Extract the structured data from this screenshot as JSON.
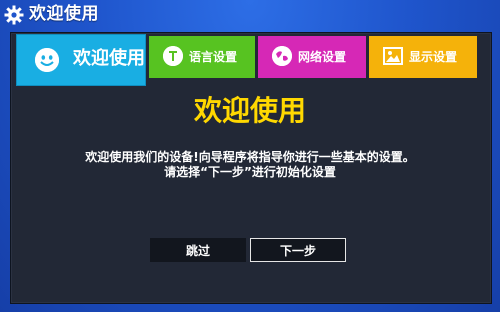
{
  "window": {
    "title": "欢迎使用",
    "icon": "gear-icon"
  },
  "tabs": [
    {
      "label": "欢迎使用",
      "icon": "smiley-icon",
      "color": "#19aee3",
      "active": true
    },
    {
      "label": "语言设置",
      "icon": "text-bubble-icon",
      "color": "#57c321",
      "active": false
    },
    {
      "label": "网络设置",
      "icon": "globe-icon",
      "color": "#d628b6",
      "active": false
    },
    {
      "label": "显示设置",
      "icon": "picture-icon",
      "color": "#f5b20a",
      "active": false
    }
  ],
  "content": {
    "heading": "欢迎使用",
    "line1": "欢迎使用我们的设备!向导程序将指导你进行一些基本的设置。",
    "line2": "请选择“下一步”进行初始化设置"
  },
  "buttons": {
    "skip": "跳过",
    "next": "下一步"
  },
  "colors": {
    "heading": "#ffd800",
    "background": "#1f55cc",
    "panel": "#222836"
  }
}
